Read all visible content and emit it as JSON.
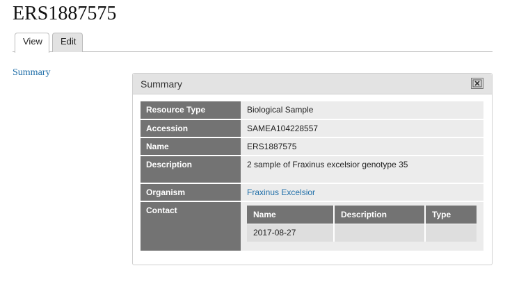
{
  "page": {
    "title": "ERS1887575"
  },
  "tabs": {
    "view": "View",
    "edit": "Edit"
  },
  "sidebar": {
    "summary_link": "Summary"
  },
  "panel": {
    "title": "Summary",
    "rows": {
      "resource_type": {
        "label": "Resource Type",
        "value": "Biological Sample"
      },
      "accession": {
        "label": "Accession",
        "value": "SAMEA104228557"
      },
      "name": {
        "label": "Name",
        "value": "ERS1887575"
      },
      "description": {
        "label": "Description",
        "value": "2 sample of Fraxinus excelsior genotype 35"
      },
      "organism": {
        "label": "Organism",
        "value": "Fraxinus Excelsior"
      },
      "contact": {
        "label": "Contact"
      }
    },
    "contact_table": {
      "headers": {
        "name": "Name",
        "description": "Description",
        "type": "Type"
      },
      "rows": [
        {
          "name": "2017-08-27",
          "description": "",
          "type": ""
        }
      ]
    }
  },
  "icons": {
    "close": "close-icon"
  },
  "colors": {
    "link": "#1f6ea8",
    "label_bg": "#737373",
    "value_bg": "#ececec"
  }
}
